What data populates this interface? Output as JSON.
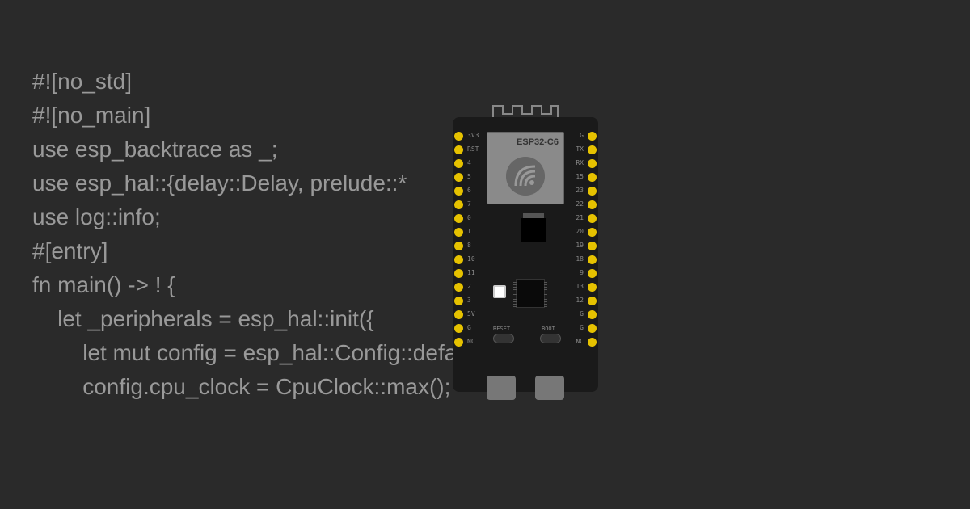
{
  "code": {
    "line1": "#![no_std]",
    "line2": "#![no_main]",
    "line3": "",
    "line4": "use esp_backtrace as _;",
    "line5": "use esp_hal::{delay::Delay, prelude::*",
    "line6": "use log::info;",
    "line7": "",
    "line8": "#[entry]",
    "line9": "fn main() -> ! {",
    "line10": "    let _peripherals = esp_hal::init({",
    "line11": "        let mut config = esp_hal::Config::default();",
    "line12": "        config.cpu_clock = CpuClock::max();"
  },
  "board": {
    "chip_name": "ESP32-C6",
    "buttons": {
      "reset": "RESET",
      "boot": "BOOT"
    },
    "pins_left": [
      "3V3",
      "RST",
      "4",
      "5",
      "6",
      "7",
      "0",
      "1",
      "8",
      "10",
      "11",
      "2",
      "3",
      "5V",
      "G",
      "NC"
    ],
    "pins_right": [
      "G",
      "TX",
      "RX",
      "15",
      "23",
      "22",
      "21",
      "20",
      "19",
      "18",
      "9",
      "13",
      "12",
      "G",
      "G",
      "NC"
    ]
  }
}
